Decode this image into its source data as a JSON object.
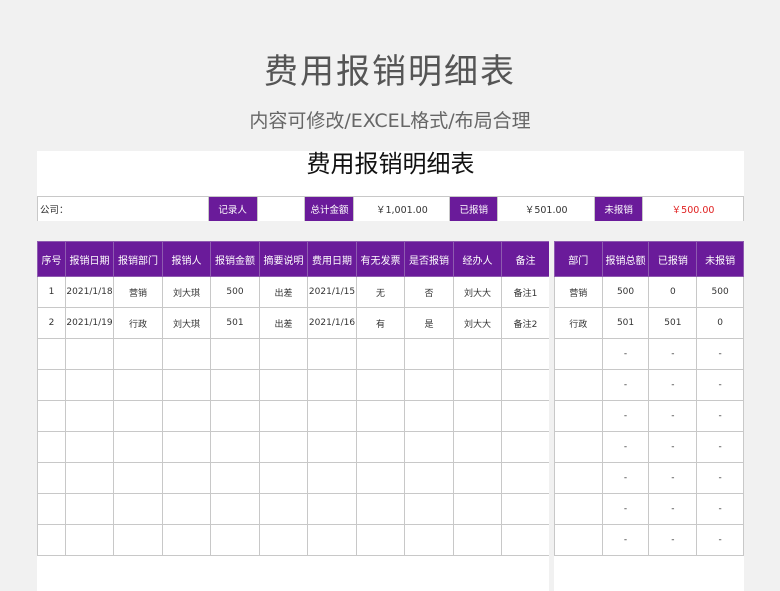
{
  "page": {
    "title": "费用报销明细表",
    "subtitle": "内容可修改/EXCEL格式/布局合理"
  },
  "sheet": {
    "title": "费用报销明细表",
    "info": {
      "company_label": "公司：",
      "recorder_label": "记录人",
      "recorder_value": "",
      "total_label": "总计金额",
      "total_value": "￥1,001.00",
      "reimbursed_label": "已报销",
      "reimbursed_value": "￥501.00",
      "unreimbursed_label": "未报销",
      "unreimbursed_value": "￥500.00"
    },
    "main_headers": [
      "序号",
      "报销日期",
      "报销部门",
      "报销人",
      "报销金额",
      "摘要说明",
      "费用日期",
      "有无发票",
      "是否报销",
      "经办人",
      "备注"
    ],
    "main_rows": [
      [
        "1",
        "2021/1/18",
        "营销",
        "刘大琪",
        "500",
        "出差",
        "2021/1/15",
        "无",
        "否",
        "刘大大",
        "备注1"
      ],
      [
        "2",
        "2021/1/19",
        "行政",
        "刘大琪",
        "501",
        "出差",
        "2021/1/16",
        "有",
        "是",
        "刘大大",
        "备注2"
      ],
      [
        "",
        "",
        "",
        "",
        "",
        "",
        "",
        "",
        "",
        "",
        ""
      ],
      [
        "",
        "",
        "",
        "",
        "",
        "",
        "",
        "",
        "",
        "",
        ""
      ],
      [
        "",
        "",
        "",
        "",
        "",
        "",
        "",
        "",
        "",
        "",
        ""
      ],
      [
        "",
        "",
        "",
        "",
        "",
        "",
        "",
        "",
        "",
        "",
        ""
      ],
      [
        "",
        "",
        "",
        "",
        "",
        "",
        "",
        "",
        "",
        "",
        ""
      ],
      [
        "",
        "",
        "",
        "",
        "",
        "",
        "",
        "",
        "",
        "",
        ""
      ],
      [
        "",
        "",
        "",
        "",
        "",
        "",
        "",
        "",
        "",
        "",
        ""
      ]
    ],
    "side_headers": [
      "部门",
      "报销总额",
      "已报销",
      "未报销"
    ],
    "side_rows": [
      [
        "营销",
        "500",
        "0",
        "500"
      ],
      [
        "行政",
        "501",
        "501",
        "0"
      ],
      [
        "",
        "-",
        "-",
        "-"
      ],
      [
        "",
        "-",
        "-",
        "-"
      ],
      [
        "",
        "-",
        "-",
        "-"
      ],
      [
        "",
        "-",
        "-",
        "-"
      ],
      [
        "",
        "-",
        "-",
        "-"
      ],
      [
        "",
        "-",
        "-",
        "-"
      ],
      [
        "",
        "-",
        "-",
        "-"
      ]
    ]
  }
}
